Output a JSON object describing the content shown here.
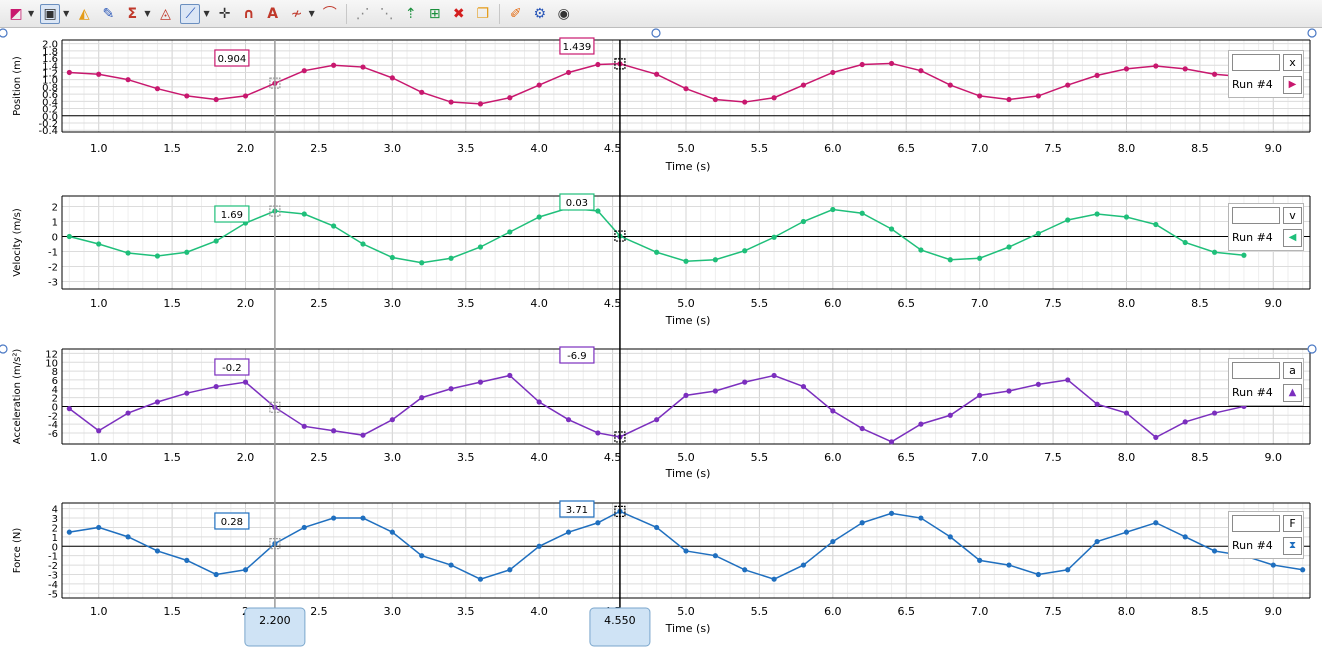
{
  "toolbar": {
    "icons": [
      "graph-options-icon",
      "data-browser-icon",
      "analyze-color-icon",
      "stats-tool-icon",
      "sigma-icon",
      "integral-icon",
      "zoom-region-icon",
      "crosshair-icon",
      "curve-fit-icon",
      "annotation-icon",
      "smooth-icon",
      "tangent-icon",
      "interpolate-icon",
      "delta-icon",
      "autoscale-icon",
      "zoom-box-icon",
      "delete-icon",
      "duplicate-icon",
      "pin-icon",
      "settings-icon",
      "eye-icon"
    ]
  },
  "cursors": {
    "left": "2.200",
    "right": "4.550"
  },
  "chart_data": [
    {
      "type": "line",
      "ylabel": "Position (m)",
      "xlabel": "Time (s)",
      "xlim": [
        0.75,
        9.25
      ],
      "ylim": [
        -0.45,
        2.1
      ],
      "xticks": [
        "1.0",
        "1.5",
        "2.0",
        "2.5",
        "3.0",
        "3.5",
        "4.0",
        "4.5",
        "5.0",
        "5.5",
        "6.0",
        "6.5",
        "7.0",
        "7.5",
        "8.0",
        "8.5",
        "9.0"
      ],
      "yticks": [
        -0.4,
        -0.2,
        0.0,
        0.2,
        0.4,
        0.6,
        0.8,
        1.0,
        1.2,
        1.4,
        1.6,
        1.8,
        2.0
      ],
      "ytick_labels": [
        "-0.4",
        "-0.2",
        "0.0",
        "0.2",
        "0.4",
        "0.6",
        "0.8",
        "1.0",
        "1.2",
        "1.4",
        "1.6",
        "1.8",
        "2.0"
      ],
      "color": "#c8186e",
      "series": [
        {
          "x": [
            0.8,
            1.0,
            1.2,
            1.4,
            1.6,
            1.8,
            2.0,
            2.2,
            2.4,
            2.6,
            2.8,
            3.0,
            3.2,
            3.4,
            3.6,
            3.8,
            4.0,
            4.2,
            4.4,
            4.55,
            4.8,
            5.0,
            5.2,
            5.4,
            5.6,
            5.8,
            6.0,
            6.2,
            6.4,
            6.6,
            6.8,
            7.0,
            7.2,
            7.4,
            7.6,
            7.8,
            8.0,
            8.2,
            8.4,
            8.6,
            8.8
          ],
          "y": [
            1.2,
            1.15,
            1.0,
            0.75,
            0.55,
            0.45,
            0.55,
            0.9,
            1.25,
            1.4,
            1.35,
            1.05,
            0.65,
            0.38,
            0.33,
            0.5,
            0.85,
            1.2,
            1.42,
            1.44,
            1.15,
            0.75,
            0.45,
            0.38,
            0.5,
            0.85,
            1.2,
            1.42,
            1.45,
            1.25,
            0.85,
            0.55,
            0.45,
            0.55,
            0.85,
            1.12,
            1.3,
            1.38,
            1.3,
            1.15,
            1.08
          ]
        }
      ],
      "legend": {
        "var": "x",
        "run": "Run #4",
        "marker": "▶"
      },
      "labels": [
        {
          "text": "0.904",
          "x": 2.2,
          "y": 0.904
        },
        {
          "text": "1.439",
          "x": 4.55,
          "y": 1.439
        }
      ]
    },
    {
      "type": "line",
      "ylabel": "Velocity (m/s)",
      "xlabel": "Time (s)",
      "xlim": [
        0.75,
        9.25
      ],
      "ylim": [
        -3.5,
        2.7
      ],
      "xticks": [
        "1.0",
        "1.5",
        "2.0",
        "2.5",
        "3.0",
        "3.5",
        "4.0",
        "4.5",
        "5.0",
        "5.5",
        "6.0",
        "6.5",
        "7.0",
        "7.5",
        "8.0",
        "8.5",
        "9.0"
      ],
      "yticks": [
        -3,
        -2,
        -1,
        0,
        1,
        2
      ],
      "ytick_labels": [
        "-3",
        "-2",
        "-1",
        "0",
        "1",
        "2"
      ],
      "color": "#1fbf7a",
      "series": [
        {
          "x": [
            0.8,
            1.0,
            1.2,
            1.4,
            1.6,
            1.8,
            2.0,
            2.2,
            2.4,
            2.6,
            2.8,
            3.0,
            3.2,
            3.4,
            3.6,
            3.8,
            4.0,
            4.2,
            4.4,
            4.55,
            4.8,
            5.0,
            5.2,
            5.4,
            5.6,
            5.8,
            6.0,
            6.2,
            6.4,
            6.6,
            6.8,
            7.0,
            7.2,
            7.4,
            7.6,
            7.8,
            8.0,
            8.2,
            8.4,
            8.6,
            8.8
          ],
          "y": [
            0.0,
            -0.5,
            -1.1,
            -1.3,
            -1.05,
            -0.3,
            0.9,
            1.7,
            1.5,
            0.7,
            -0.5,
            -1.4,
            -1.75,
            -1.45,
            -0.7,
            0.3,
            1.3,
            1.9,
            1.7,
            0.03,
            -1.05,
            -1.65,
            -1.55,
            -0.95,
            -0.05,
            1.0,
            1.8,
            1.55,
            0.5,
            -0.9,
            -1.55,
            -1.45,
            -0.7,
            0.2,
            1.1,
            1.5,
            1.3,
            0.8,
            -0.4,
            -1.05,
            -1.25
          ]
        }
      ],
      "legend": {
        "var": "v",
        "run": "Run #4",
        "marker": "◀"
      },
      "labels": [
        {
          "text": "1.69",
          "x": 2.2,
          "y": 1.69
        },
        {
          "text": "0.03",
          "x": 4.55,
          "y": 0.03
        }
      ]
    },
    {
      "type": "line",
      "ylabel": "Acceleration (m/s²)",
      "xlabel": "Time (s)",
      "xlim": [
        0.75,
        9.25
      ],
      "ylim": [
        -8.5,
        13
      ],
      "xticks": [
        "1.0",
        "1.5",
        "2.0",
        "2.5",
        "3.0",
        "3.5",
        "4.0",
        "4.5",
        "5.0",
        "5.5",
        "6.0",
        "6.5",
        "7.0",
        "7.5",
        "8.0",
        "8.5",
        "9.0"
      ],
      "yticks": [
        -6,
        -4,
        -2,
        0,
        2,
        4,
        6,
        8,
        10,
        12
      ],
      "ytick_labels": [
        "-6",
        "-4",
        "-2",
        "0",
        "2",
        "4",
        "6",
        "8",
        "10",
        "12"
      ],
      "color": "#7b2fbe",
      "series": [
        {
          "x": [
            0.8,
            1.0,
            1.2,
            1.4,
            1.6,
            1.8,
            2.0,
            2.2,
            2.4,
            2.6,
            2.8,
            3.0,
            3.2,
            3.4,
            3.6,
            3.8,
            4.0,
            4.2,
            4.4,
            4.55,
            4.8,
            5.0,
            5.2,
            5.4,
            5.6,
            5.8,
            6.0,
            6.2,
            6.4,
            6.6,
            6.8,
            7.0,
            7.2,
            7.4,
            7.6,
            7.8,
            8.0,
            8.2,
            8.4,
            8.6,
            8.8
          ],
          "y": [
            -0.5,
            -5.5,
            -1.5,
            1.0,
            3.0,
            4.5,
            5.5,
            -0.2,
            -4.5,
            -5.5,
            -6.5,
            -3.0,
            2.0,
            4.0,
            5.5,
            7.0,
            1.0,
            -3.0,
            -6.0,
            -6.9,
            -3.0,
            2.5,
            3.5,
            5.5,
            7.0,
            4.5,
            -1.0,
            -5.0,
            -8.0,
            -4.0,
            -2.0,
            2.5,
            3.5,
            5.0,
            6.0,
            0.5,
            -1.5,
            -7.0,
            -3.5,
            -1.5,
            0.0
          ]
        }
      ],
      "legend": {
        "var": "a",
        "run": "Run #4",
        "marker": "▲"
      },
      "labels": [
        {
          "text": "-0.2",
          "x": 2.2,
          "y": -0.2
        },
        {
          "text": "-6.9",
          "x": 4.55,
          "y": -6.9
        }
      ]
    },
    {
      "type": "line",
      "ylabel": "Force (N)",
      "xlabel": "Time (s)",
      "xlim": [
        0.75,
        9.25
      ],
      "ylim": [
        -5.5,
        4.6
      ],
      "xticks": [
        "1.0",
        "1.5",
        "2",
        "2.5",
        "3.0",
        "3.5",
        "4.0",
        "4.5",
        "5.0",
        "5.5",
        "6.0",
        "6.5",
        "7.0",
        "7.5",
        "8.0",
        "8.5",
        "9.0"
      ],
      "yticks": [
        -5,
        -4,
        -3,
        -2,
        -1,
        0,
        1,
        2,
        3,
        4
      ],
      "ytick_labels": [
        "-5",
        "-4",
        "-3",
        "-2",
        "-1",
        "0",
        "1",
        "2",
        "3",
        "4"
      ],
      "color": "#1f6fbf",
      "series": [
        {
          "x": [
            0.8,
            1.0,
            1.2,
            1.4,
            1.6,
            1.8,
            2.0,
            2.2,
            2.4,
            2.6,
            2.8,
            3.0,
            3.2,
            3.4,
            3.6,
            3.8,
            4.0,
            4.2,
            4.4,
            4.55,
            4.8,
            5.0,
            5.2,
            5.4,
            5.6,
            5.8,
            6.0,
            6.2,
            6.4,
            6.6,
            6.8,
            7.0,
            7.2,
            7.4,
            7.6,
            7.8,
            8.0,
            8.2,
            8.4,
            8.6,
            8.8,
            9.0,
            9.2
          ],
          "y": [
            1.5,
            2.0,
            1.0,
            -0.5,
            -1.5,
            -3.0,
            -2.5,
            0.28,
            2.0,
            3.0,
            3.0,
            1.5,
            -1.0,
            -2.0,
            -3.5,
            -2.5,
            0.0,
            1.5,
            2.5,
            3.71,
            2.0,
            -0.5,
            -1.0,
            -2.5,
            -3.5,
            -2.0,
            0.5,
            2.5,
            3.5,
            3.0,
            1.0,
            -1.5,
            -2.0,
            -3.0,
            -2.5,
            0.5,
            1.5,
            2.5,
            1.0,
            -0.5,
            -1.0,
            -2.0,
            -2.5
          ]
        }
      ],
      "legend": {
        "var": "F",
        "run": "Run #4",
        "marker": "⧗"
      },
      "labels": [
        {
          "text": "0.28",
          "x": 2.2,
          "y": 0.28
        },
        {
          "text": "3.71",
          "x": 4.55,
          "y": 3.71
        }
      ]
    }
  ]
}
